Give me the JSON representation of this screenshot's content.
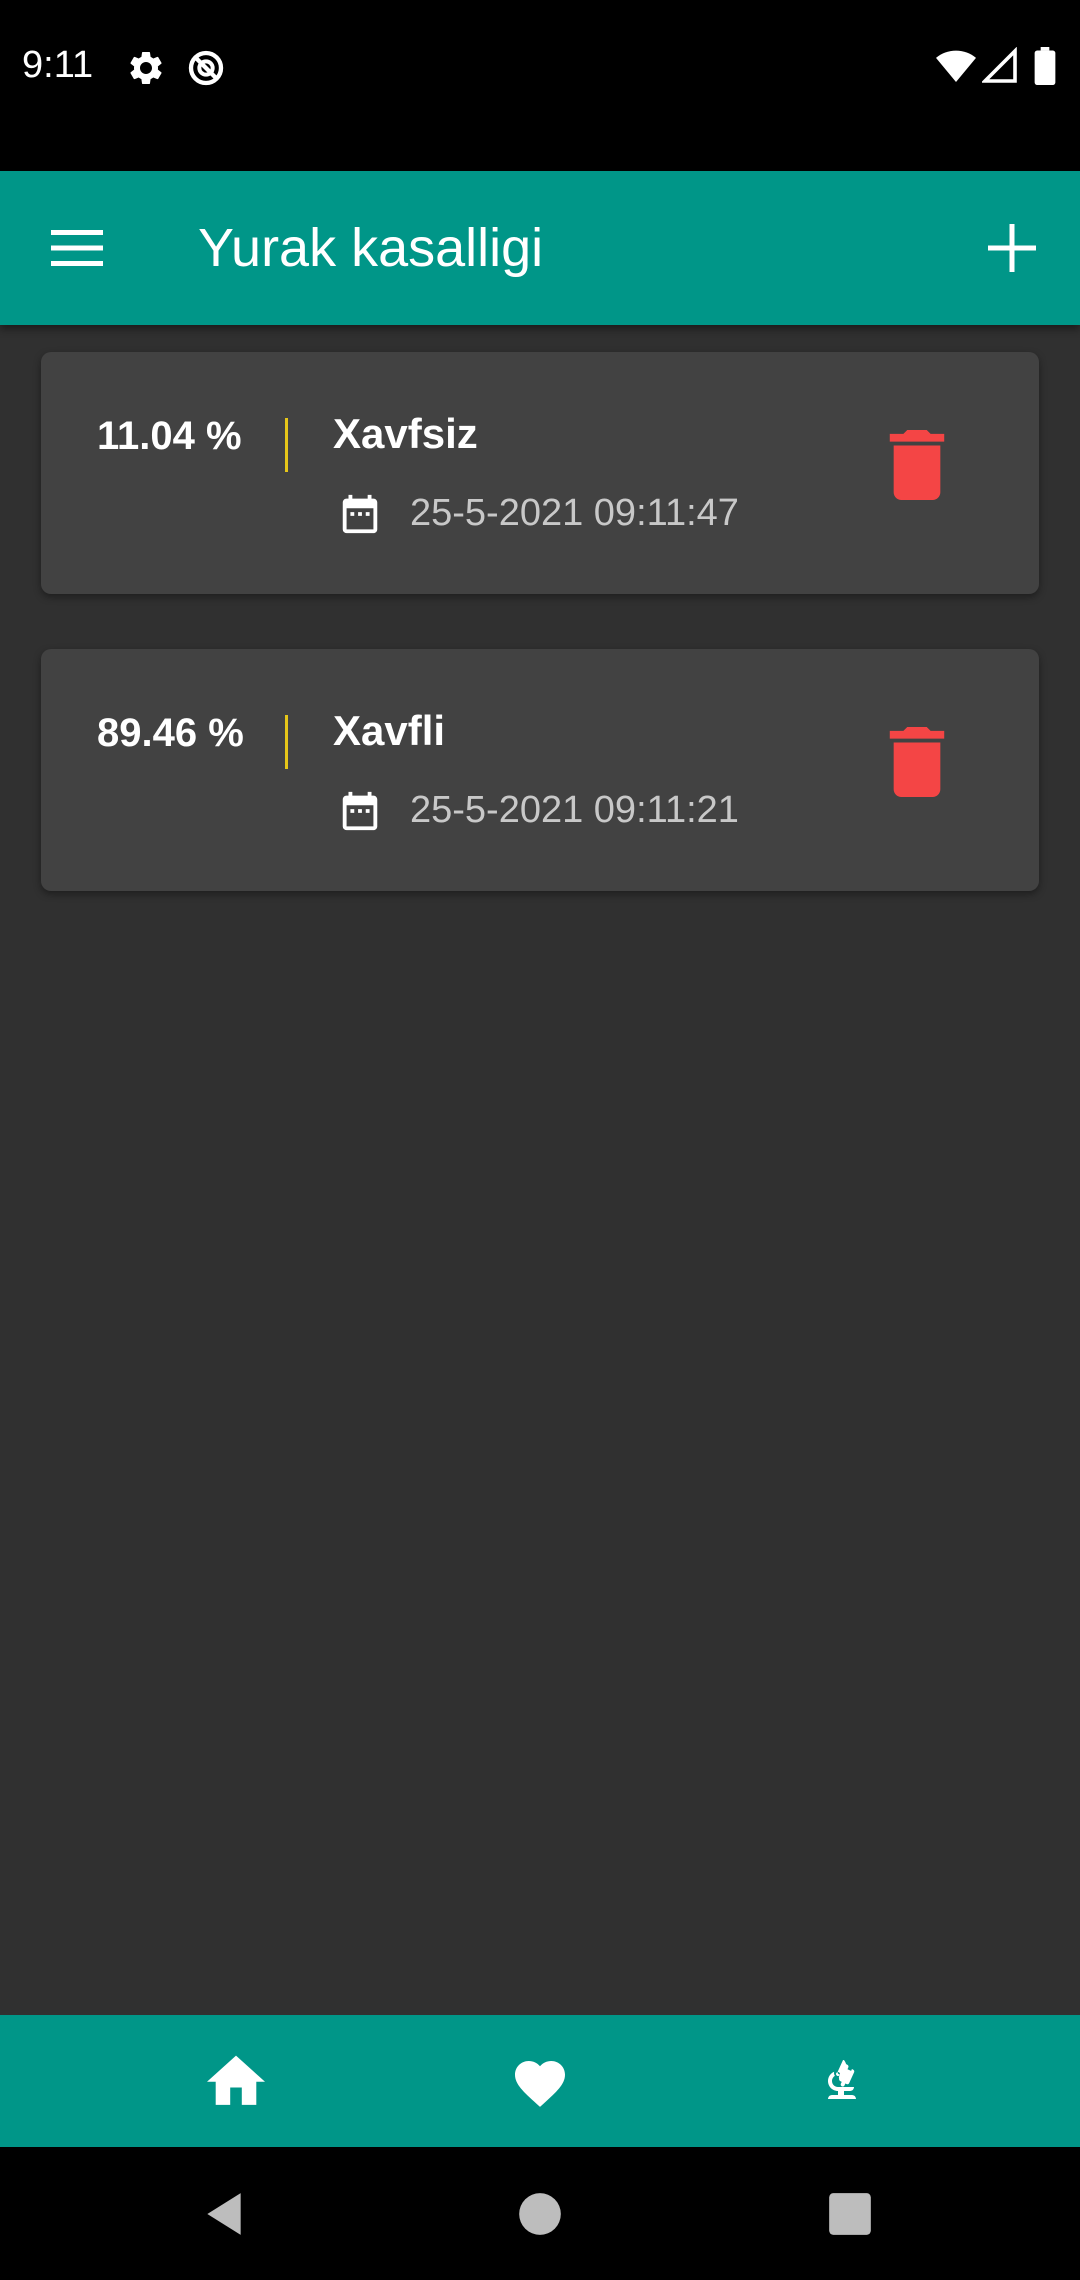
{
  "status_bar": {
    "time": "9:11",
    "left_icons": [
      "gear-icon",
      "do-not-disturb-icon"
    ],
    "right_icons": [
      "wifi-icon",
      "signal-icon",
      "battery-icon"
    ]
  },
  "app_bar": {
    "title": "Yurak kasalligi",
    "menu_icon": "menu-icon",
    "add_icon": "plus-icon",
    "color": "#009688"
  },
  "records": [
    {
      "percent": "11.04 %",
      "status": "Xavfsiz",
      "date": "25-5-2021 09:11:47"
    },
    {
      "percent": "89.46 %",
      "status": "Xavfli",
      "date": "25-5-2021 09:11:21"
    }
  ],
  "colors": {
    "background": "#303030",
    "card": "#424242",
    "divider": "#e6c619",
    "delete": "#f44545",
    "date_text": "#c8c8c8"
  },
  "bottom_nav": {
    "items": [
      {
        "icon": "home-icon"
      },
      {
        "icon": "heart-icon"
      },
      {
        "icon": "microscope-icon"
      }
    ]
  },
  "system_nav": [
    "back-icon",
    "home-circle-icon",
    "recents-icon"
  ]
}
